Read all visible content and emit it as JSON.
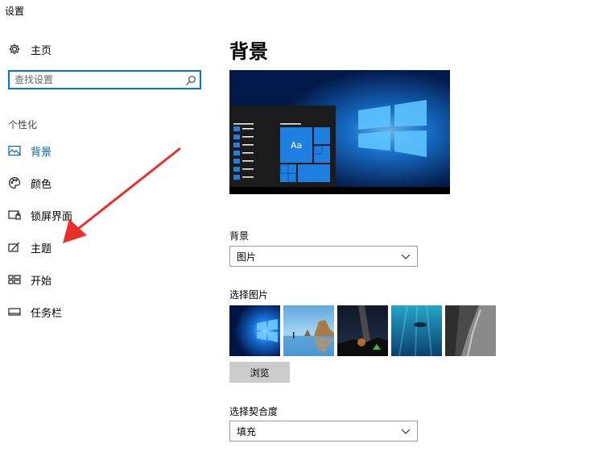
{
  "window": {
    "title": "设置"
  },
  "sidebar": {
    "home_label": "主页",
    "search_placeholder": "查找设置",
    "section_label": "个性化",
    "items": [
      {
        "label": "背景",
        "icon": "picture-icon",
        "active": true
      },
      {
        "label": "颜色",
        "icon": "palette-icon",
        "active": false
      },
      {
        "label": "锁屏界面",
        "icon": "lock-screen-icon",
        "active": false
      },
      {
        "label": "主题",
        "icon": "theme-brush-icon",
        "active": false
      },
      {
        "label": "开始",
        "icon": "start-grid-icon",
        "active": false
      },
      {
        "label": "任务栏",
        "icon": "taskbar-icon",
        "active": false
      }
    ]
  },
  "main": {
    "heading": "背景",
    "preview": {
      "tile_text": "Aa"
    },
    "background_label": "背景",
    "background_value": "图片",
    "choose_picture_label": "选择图片",
    "browse_label": "浏览",
    "fit_label": "选择契合度",
    "fit_value": "填充"
  },
  "colors": {
    "accent": "#0078d7",
    "active_text": "#0063b1",
    "annotation_arrow": "#e8302a"
  }
}
